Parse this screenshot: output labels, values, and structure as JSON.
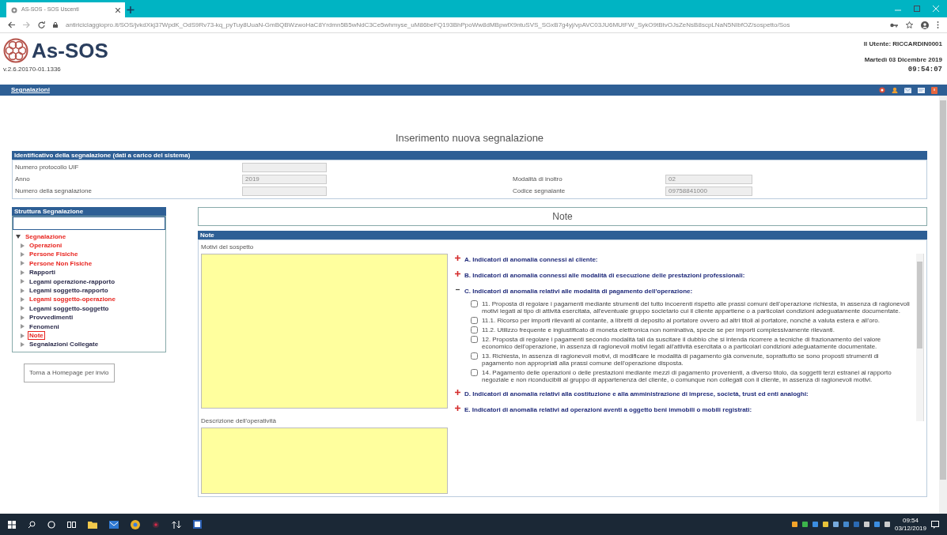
{
  "browser": {
    "tab_title": "AS-SOS - SOS Uscenti",
    "url": "antiriciclaggiopro.it/SOS/jvkdXkj37WpdK_OdS9Rv73-kq_pyTuy8UuaN-GmBQBWzwoHaC8Yrdmn5B5wNdC3Ce5whmyse_uM86beFQ193BhPpoWw8dMBpwfX9ntuSVS_SGxB7g4yj/vpAVC03JU6MUtFW_SykO9tBtvOJsZeNsB8scpLNaN5NIbfOZ/sospetto/Sos"
  },
  "app": {
    "logo_text": "As-SOS",
    "version": "v.2.6.20170-01.1336",
    "user_label": "Il Utente:",
    "user_name": "RICCARDIN0001",
    "date": "Martedì 03 Dicembre 2019",
    "time": "09:54:07"
  },
  "menu": [
    {
      "label": "Segnalazioni",
      "selected": true
    }
  ],
  "page_title": "Inserimento nuova segnalazione",
  "identification": {
    "title": "Identificativo della segnalazione (dati a carico del sistema)",
    "rows": [
      [
        {
          "label": "Numero protocollo UIF"
        }
      ],
      [
        {
          "label": "Anno",
          "value": "2019"
        },
        {
          "label": "Modalità di inoltro",
          "value": "02"
        }
      ],
      [
        {
          "label": "Numero della segnalazione"
        },
        {
          "label": "Codice segnalante",
          "value": "09758841000"
        }
      ]
    ]
  },
  "tree": {
    "title": "Struttura Segnalazione",
    "root": {
      "label": "Segnalazione",
      "expanded": true,
      "incomplete": true,
      "selected": false,
      "children": [
        {
          "label": "Operazioni",
          "incomplete": true,
          "selected": false
        },
        {
          "label": "Persone Fisiche",
          "incomplete": true,
          "selected": false
        },
        {
          "label": "Persone Non Fisiche",
          "incomplete": true,
          "selected": false
        },
        {
          "label": "Rapporti",
          "incomplete": false,
          "selected": false
        },
        {
          "label": "Legami operazione-rapporto",
          "incomplete": false,
          "selected": false
        },
        {
          "label": "Legami soggetto-rapporto",
          "incomplete": false,
          "selected": false
        },
        {
          "label": "Legami soggetto-operazione",
          "incomplete": true,
          "selected": false
        },
        {
          "label": "Legami soggetto-soggetto",
          "incomplete": false,
          "selected": false
        },
        {
          "label": "Provvedimenti",
          "incomplete": false,
          "selected": false
        },
        {
          "label": "Fenomeni",
          "incomplete": false,
          "selected": false
        },
        {
          "label": "Note",
          "incomplete": true,
          "selected": true
        },
        {
          "label": "Segnalazioni Collegate",
          "incomplete": false,
          "selected": false
        }
      ]
    }
  },
  "home_button": "Torna a Homepage per invio",
  "note_panel": {
    "title": "Note",
    "section": "Note",
    "fields": [
      {
        "label": "Motivi del sospetto"
      },
      {
        "label": "Descrizione dell'operatività"
      }
    ],
    "indicators": [
      {
        "label": "A. Indicatori di anomalia connessi al cliente:",
        "expanded": false
      },
      {
        "label": "B. Indicatori di anomalia connessi alle modalità di esecuzione delle prestazioni professionali:",
        "expanded": false
      },
      {
        "label": "C. Indicatori di anomalia relativi alle modalità di pagamento dell'operazione:",
        "expanded": true,
        "items": [
          {
            "text": "11. Proposta di regolare i pagamenti mediante strumenti del tutto incoerenti rispetto alle prassi comuni dell'operazione richiesta, in assenza di ragionevoli motivi legati al tipo di attività esercitata, all'eventuale gruppo societario cui il cliente appartiene o a particolari condizioni adeguatamente documentate.",
            "checked": false
          },
          {
            "text": "11.1. Ricorso per importi rilevanti al contante, a libretti di deposito al portatore ovvero ad altri titoli al portatore, nonché a valuta estera e all'oro.",
            "checked": false
          },
          {
            "text": "11.2. Utilizzo frequente e ingiustificato di moneta elettronica non nominativa, specie se per importi complessivamente rilevanti.",
            "checked": false
          },
          {
            "text": "12. Proposta di regolare i pagamenti secondo modalità tali da suscitare il dubbio che si intenda ricorrere a tecniche di frazionamento del valore economico dell'operazione, in assenza di ragionevoli motivi legati all'attività esercitata o a particolari condizioni adeguatamente documentate.",
            "checked": false
          },
          {
            "text": "13. Richiesta, in assenza di ragionevoli motivi, di modificare le modalità di pagamento già convenute, soprattutto se sono proposti strumenti di pagamento non appropriati alla prassi comune dell'operazione disposta.",
            "checked": false
          },
          {
            "text": "14. Pagamento delle operazioni o delle prestazioni mediante mezzi di pagamento provenienti, a diverso titolo, da soggetti terzi estranei al rapporto negoziale e non riconducibili al gruppo di appartenenza del cliente, o comunque non collegati con il cliente, in assenza di ragionevoli motivi.",
            "checked": false
          }
        ]
      },
      {
        "label": "D. Indicatori di anomalia relativi alla costituzione e alla amministrazione di imprese, società, trust ed enti analoghi:",
        "expanded": false
      },
      {
        "label": "E. Indicatori di anomalia relativi ad operazioni aventi a oggetto beni immobili o mobili registrati:",
        "expanded": false
      }
    ]
  },
  "taskbar": {
    "time": "09:54",
    "date": "03/12/2019"
  }
}
